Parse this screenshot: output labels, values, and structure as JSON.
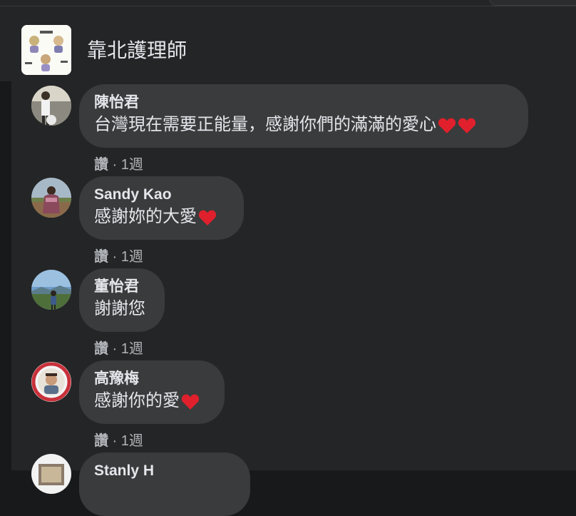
{
  "page": {
    "name": "靠北護理師"
  },
  "comments": [
    {
      "author": "陳怡君",
      "text": "台灣現在需要正能量，感謝你們的滿滿的愛心",
      "hearts": 2,
      "like_label": "讚",
      "separator": " · ",
      "time": "1週"
    },
    {
      "author": "Sandy Kao",
      "text": "感謝妳的大愛",
      "hearts": 1,
      "like_label": "讚",
      "separator": " · ",
      "time": "1週"
    },
    {
      "author": "董怡君",
      "text": "謝謝您",
      "hearts": 0,
      "like_label": "讚",
      "separator": " · ",
      "time": "1週"
    },
    {
      "author": "高豫梅",
      "text": "感謝你的愛",
      "hearts": 1,
      "like_label": "讚",
      "separator": " · ",
      "time": "1週"
    },
    {
      "author": "Stanly H"
    }
  ],
  "icons": {
    "reaction": "heart-emoji-icon"
  },
  "colors": {
    "bubble": "#3a3b3c",
    "heart": "#e0202c",
    "panel": "#242526",
    "meta": "#b0b3b8"
  }
}
